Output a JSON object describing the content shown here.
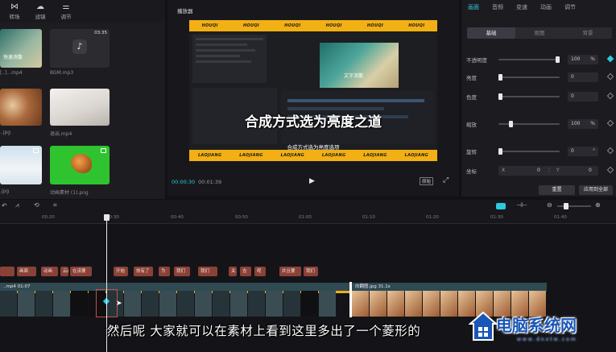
{
  "toolbar": {
    "items": [
      {
        "label": "转场",
        "icon": "transition-icon"
      },
      {
        "label": "滤镜",
        "icon": "filter-icon"
      },
      {
        "label": "调节",
        "icon": "adjust-icon"
      }
    ]
  },
  "media": {
    "items": [
      {
        "name": "[..]...mp4",
        "overlay": "快速消散"
      },
      {
        "name": "BGM.mp3",
        "duration": "03:35"
      },
      {
        "name": "..jpg"
      },
      {
        "name": "退出.mp4"
      },
      {
        "name": ".jpg"
      },
      {
        "name": "动画素材 (1).png"
      }
    ]
  },
  "player": {
    "title": "播放器",
    "band_word_top": "HOUQI",
    "band_word_bottom": "LAOJIANG",
    "video_title": "合成方式选为亮度之道",
    "video_inner_caption": "文字消散",
    "video_subtitle": "合成方式选为亮度选项",
    "current_time": "00:00:30",
    "total_time": "00:01:39",
    "ratio_label": "原始"
  },
  "inspector": {
    "tabs": [
      {
        "label": "画面",
        "active": true
      },
      {
        "label": "音频",
        "active": false
      },
      {
        "label": "变速",
        "active": false
      },
      {
        "label": "动画",
        "active": false
      },
      {
        "label": "调节",
        "active": false
      }
    ],
    "subtabs": [
      {
        "label": "基础",
        "active": true
      },
      {
        "label": "抠图",
        "active": false
      },
      {
        "label": "背景",
        "active": false
      }
    ],
    "properties": [
      {
        "label": "不透明度",
        "value": "100",
        "unit": "%",
        "level": 1.0,
        "keyframe_on": true
      },
      {
        "label": "亮度",
        "value": "0",
        "unit": "",
        "level": 0.0,
        "keyframe_on": false
      },
      {
        "label": "色度",
        "value": "0",
        "unit": "",
        "level": 0.0,
        "keyframe_on": false
      },
      {
        "label": "缩放",
        "value": "100",
        "unit": "%",
        "level": 0.18,
        "keyframe_on": false
      },
      {
        "label": "旋转",
        "value": "0",
        "unit": "°",
        "level": 0.0,
        "keyframe_on": false
      }
    ],
    "position": {
      "label": "坐标",
      "x_label": "X",
      "x_value": "0",
      "y_label": "Y",
      "y_value": "0"
    },
    "reset_label": "重置",
    "apply_all_label": "应用到全部"
  },
  "timeline": {
    "ticks": [
      "00:20",
      "00:30",
      "00:40",
      "00:50",
      "01:00",
      "01:10",
      "01:20",
      "01:30",
      "01:40"
    ],
    "tags": [
      "",
      "画面",
      "动画",
      "云在",
      "在该要",
      "开始",
      "效有了",
      "为",
      "我们",
      "我们",
      "关",
      "吉",
      "呢",
      "并且要",
      "我们"
    ],
    "clip1_label": "..mp4  01:07",
    "clip2_label": "向翻图.jpg  31.1s"
  },
  "caption": "然后呢  大家就可以在素材上看到这里多出了一个菱形的",
  "watermark": {
    "name": "电脑系统网",
    "url": "www.dnxtw.com"
  },
  "colors": {
    "accent": "#2ec8e0",
    "band": "#f2b014",
    "tag": "#8a4136",
    "clip_bar": "#2f4a52"
  }
}
